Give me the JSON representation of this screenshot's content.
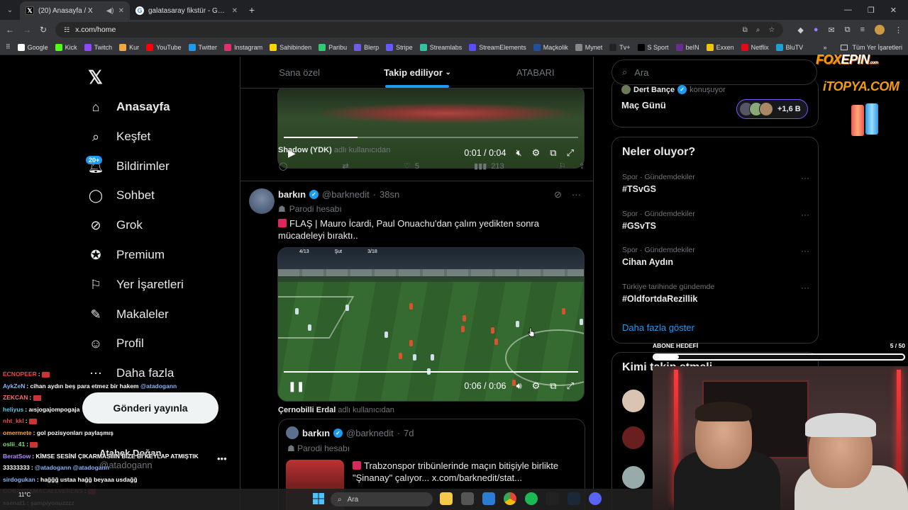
{
  "browser": {
    "tabs": [
      {
        "title": "(20) Anasayfa / X",
        "active": true
      },
      {
        "title": "galatasaray fikstür - Google'da",
        "active": false
      }
    ],
    "url": "x.com/home",
    "bookmarks": [
      "Google",
      "Kick",
      "Twitch",
      "Kur",
      "YouTube",
      "Twitter",
      "Instagram",
      "Sahibinden",
      "Paribu",
      "Blerp",
      "Stripe",
      "Streamlabs",
      "StreamElements",
      "Maçkolik",
      "Mynet",
      "Tv+",
      "S Sport",
      "beIN",
      "Exxen",
      "Netflix",
      "BluTV"
    ],
    "bookmarks_more": "»",
    "all_bookmarks": "Tüm Yer İşaretleri"
  },
  "nav": {
    "items": [
      {
        "label": "Anasayfa",
        "icon": "home-icon"
      },
      {
        "label": "Keşfet",
        "icon": "search-icon"
      },
      {
        "label": "Bildirimler",
        "icon": "bell-icon"
      },
      {
        "label": "Sohbet",
        "icon": "chat-icon"
      },
      {
        "label": "Grok",
        "icon": "grok-icon"
      },
      {
        "label": "Premium",
        "icon": "premium-icon"
      },
      {
        "label": "Yer İşaretleri",
        "icon": "bookmark-icon"
      },
      {
        "label": "Makaleler",
        "icon": "articles-icon"
      },
      {
        "label": "Profil",
        "icon": "profile-icon"
      },
      {
        "label": "Daha fazla",
        "icon": "more-icon"
      }
    ],
    "notif_badge": "20+",
    "post_button": "Gönderi yayınla",
    "account_name": "Atabek Doğan",
    "account_handle": "@atadogann"
  },
  "feed": {
    "tabs": [
      "Sana özel",
      "Takip ediliyor",
      "ATABARI"
    ],
    "tweet1": {
      "video_time": "0:01 / 0:04",
      "progress": 0.25,
      "used_by_name": "Shadow (YDK)",
      "used_by_suffix": "adlı kullanıcıdan",
      "likes": "5",
      "views": "213"
    },
    "tweet2": {
      "name": "barkın",
      "handle": "@barknedit",
      "time": "38sn",
      "parody": "Parodi hesabı",
      "text": "FLAŞ | Mauro İcardi, Paul Onuachu'dan çalım yedikten sonra mücadeleyi bıraktı..",
      "video_time": "0:06 / 0:06",
      "progress": 1.0,
      "scorebug": [
        "4/13",
        "Şut",
        "3/18"
      ],
      "used_by_name": "Çernobilli Erdal",
      "used_by_suffix": "adlı kullanıcıdan",
      "quote": {
        "name": "barkın",
        "handle": "@barknedit",
        "time": "7d",
        "parody": "Parodi hesabı",
        "text": "Trabzonspor tribünlerinde maçın bitişiyle birlikte \"Şinanay\" çalıyor... x.com/barknedit/stat..."
      }
    }
  },
  "right": {
    "search_placeholder": "Ara",
    "space": {
      "host": "Dert Bançe",
      "status": "konuşuyor",
      "title": "Maç Günü",
      "count": "+1,6 B"
    },
    "trends_title": "Neler oluyor?",
    "trends": [
      {
        "category": "Spor · Gündemdekiler",
        "tag": "#TSvGS"
      },
      {
        "category": "Spor · Gündemdekiler",
        "tag": "#GSvTS"
      },
      {
        "category": "Spor · Gündemdekiler",
        "tag": "Cihan Aydın"
      },
      {
        "category": "Türkiye tarihinde gündemde",
        "tag": "#OldfortdaRezillik"
      }
    ],
    "show_more": "Daha fazla göster",
    "who_to_follow": "Kimi takip etmeli"
  },
  "stream": {
    "sponsor1_a": "FOX",
    "sponsor1_b": "EPIN",
    "sponsor1_sub": ".com",
    "sponsor2": "iTOPYA.COM",
    "sub_goal_label": "ABONE HEDEFİ",
    "sub_goal_count": "5 / 50",
    "sub_goal_progress": 0.1,
    "chat": [
      {
        "user": "ECNOPEER",
        "color": "#e84a4a",
        "msg": "",
        "emote": true
      },
      {
        "user": "AykZeN",
        "color": "#8ab4f8",
        "msg": "cihan aydın beş para etmez bir hakem ",
        "mention": "@atadogann"
      },
      {
        "user": "ZEKCAN",
        "color": "#ff6b6b",
        "msg": "",
        "emote": true
      },
      {
        "user": "heliyus",
        "color": "#5ec8e5",
        "msg": "aısjogajompogaja",
        "mention": ""
      },
      {
        "user": "nht_kkl",
        "color": "#e84a4a",
        "msg": "",
        "emote": true
      },
      {
        "user": "omermete",
        "color": "#f5a742",
        "msg": "gol pozisyonları paylaşmış",
        "mention": ""
      },
      {
        "user": "oslii_41",
        "color": "#7ee07e",
        "msg": "",
        "emote": true
      },
      {
        "user": "BeratSow",
        "color": "#b58cff",
        "msg": "KİMSE SESİNİ ÇIKARMASIIIN BİZE Bİ KEYLAP ATMIŞTIK",
        "mention": ""
      },
      {
        "user": "33333333",
        "color": "#ffffff",
        "msg": "",
        "mention": "@atadogann @atadogann"
      },
      {
        "user": "sirdogukan",
        "color": "#8ab4f8",
        "msg": "hağğğ ustaa hağğ beyaaa usdağğ",
        "mention": ""
      },
      {
        "user": "GOBAYDAMACALLVERENS",
        "color": "#e84a4a",
        "msg": "",
        "emote": true
      },
      {
        "user": "ssenat1",
        "color": "#ffffff",
        "msg": "şampiyonuzzzz",
        "mention": ""
      }
    ]
  },
  "taskbar": {
    "temp": "11°C",
    "search": "Ara"
  }
}
